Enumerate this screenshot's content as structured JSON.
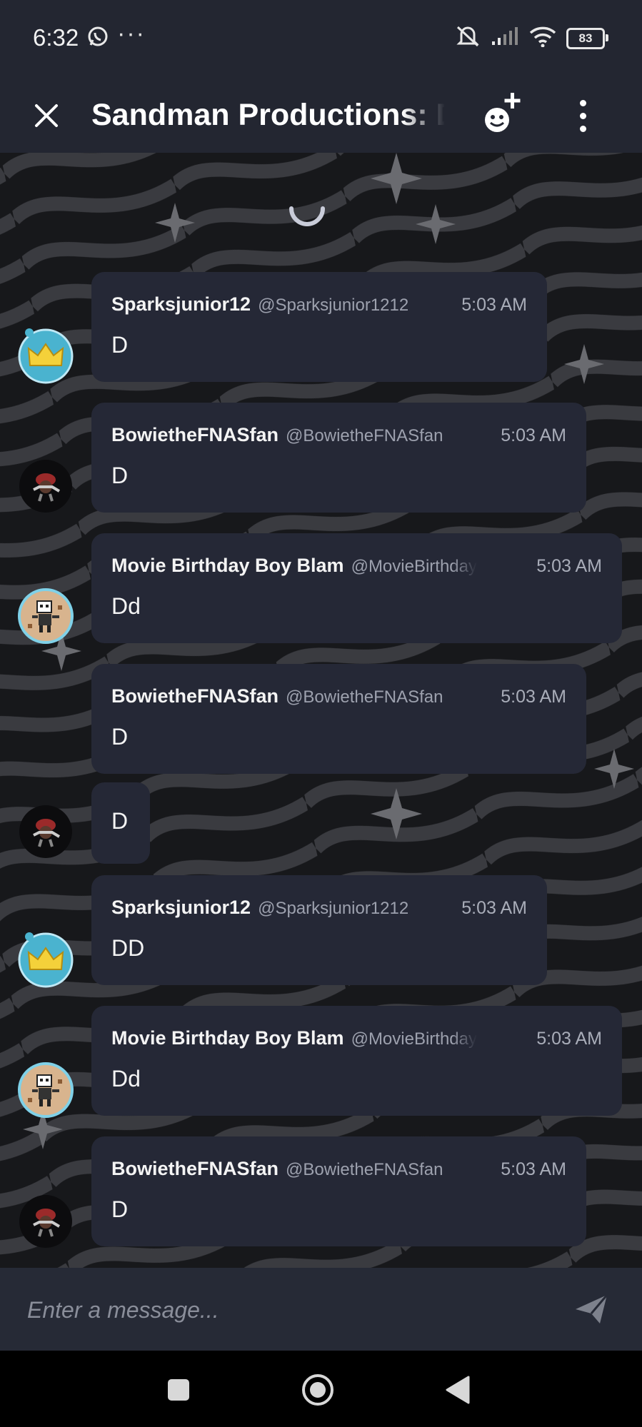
{
  "status_bar": {
    "time": "6:32",
    "notification_icons": [
      "whatsapp-icon",
      "more-dots-icon"
    ],
    "more_text": "···",
    "system_icons": [
      "mute-icon",
      "signal-icon",
      "wifi-icon",
      "battery-icon"
    ],
    "battery_percent": "83"
  },
  "header": {
    "title": "Sandman Productions: D",
    "close_icon": "close-icon",
    "add_member_icon": "add-member-icon",
    "more_icon": "vertical-dots-icon"
  },
  "colors": {
    "header_bg": "#232631",
    "bubble_bg": "#252836",
    "chat_bg": "#151619",
    "input_bg": "#262a36",
    "spinner": "#c9ccd9"
  },
  "messages": [
    {
      "username": "Sparksjunior12",
      "handle": "@Sparksjunior1212",
      "time": "5:03 AM",
      "text": "D",
      "avatar": "crown-avatar"
    },
    {
      "username": "BowietheFNASfan",
      "handle": "@BowietheFNASfan",
      "time": "5:03 AM",
      "text": "D",
      "avatar": "character-avatar"
    },
    {
      "username": "Movie Birthday Boy Blam",
      "handle": "@MovieBirthday",
      "time": "5:03 AM",
      "text": "Dd",
      "avatar": "pixel-avatar"
    },
    {
      "username": "BowietheFNASfan",
      "handle": "@BowietheFNASfan",
      "time": "5:03 AM",
      "text": "D",
      "avatar": "character-avatar"
    },
    {
      "username": "",
      "handle": "",
      "time": "",
      "text": "D",
      "avatar": "character-avatar"
    },
    {
      "username": "Sparksjunior12",
      "handle": "@Sparksjunior1212",
      "time": "5:03 AM",
      "text": "DD",
      "avatar": "crown-avatar"
    },
    {
      "username": "Movie Birthday Boy Blam",
      "handle": "@MovieBirthday",
      "time": "5:03 AM",
      "text": "Dd",
      "avatar": "pixel-avatar"
    },
    {
      "username": "BowietheFNASfan",
      "handle": "@BowietheFNASfan",
      "time": "5:03 AM",
      "text": "D",
      "avatar": "character-avatar"
    }
  ],
  "composer": {
    "placeholder": "Enter a message...",
    "send_icon": "send-icon"
  },
  "nav_bar": {
    "buttons": [
      "recents-square-icon",
      "home-circle-icon",
      "back-triangle-icon"
    ]
  }
}
